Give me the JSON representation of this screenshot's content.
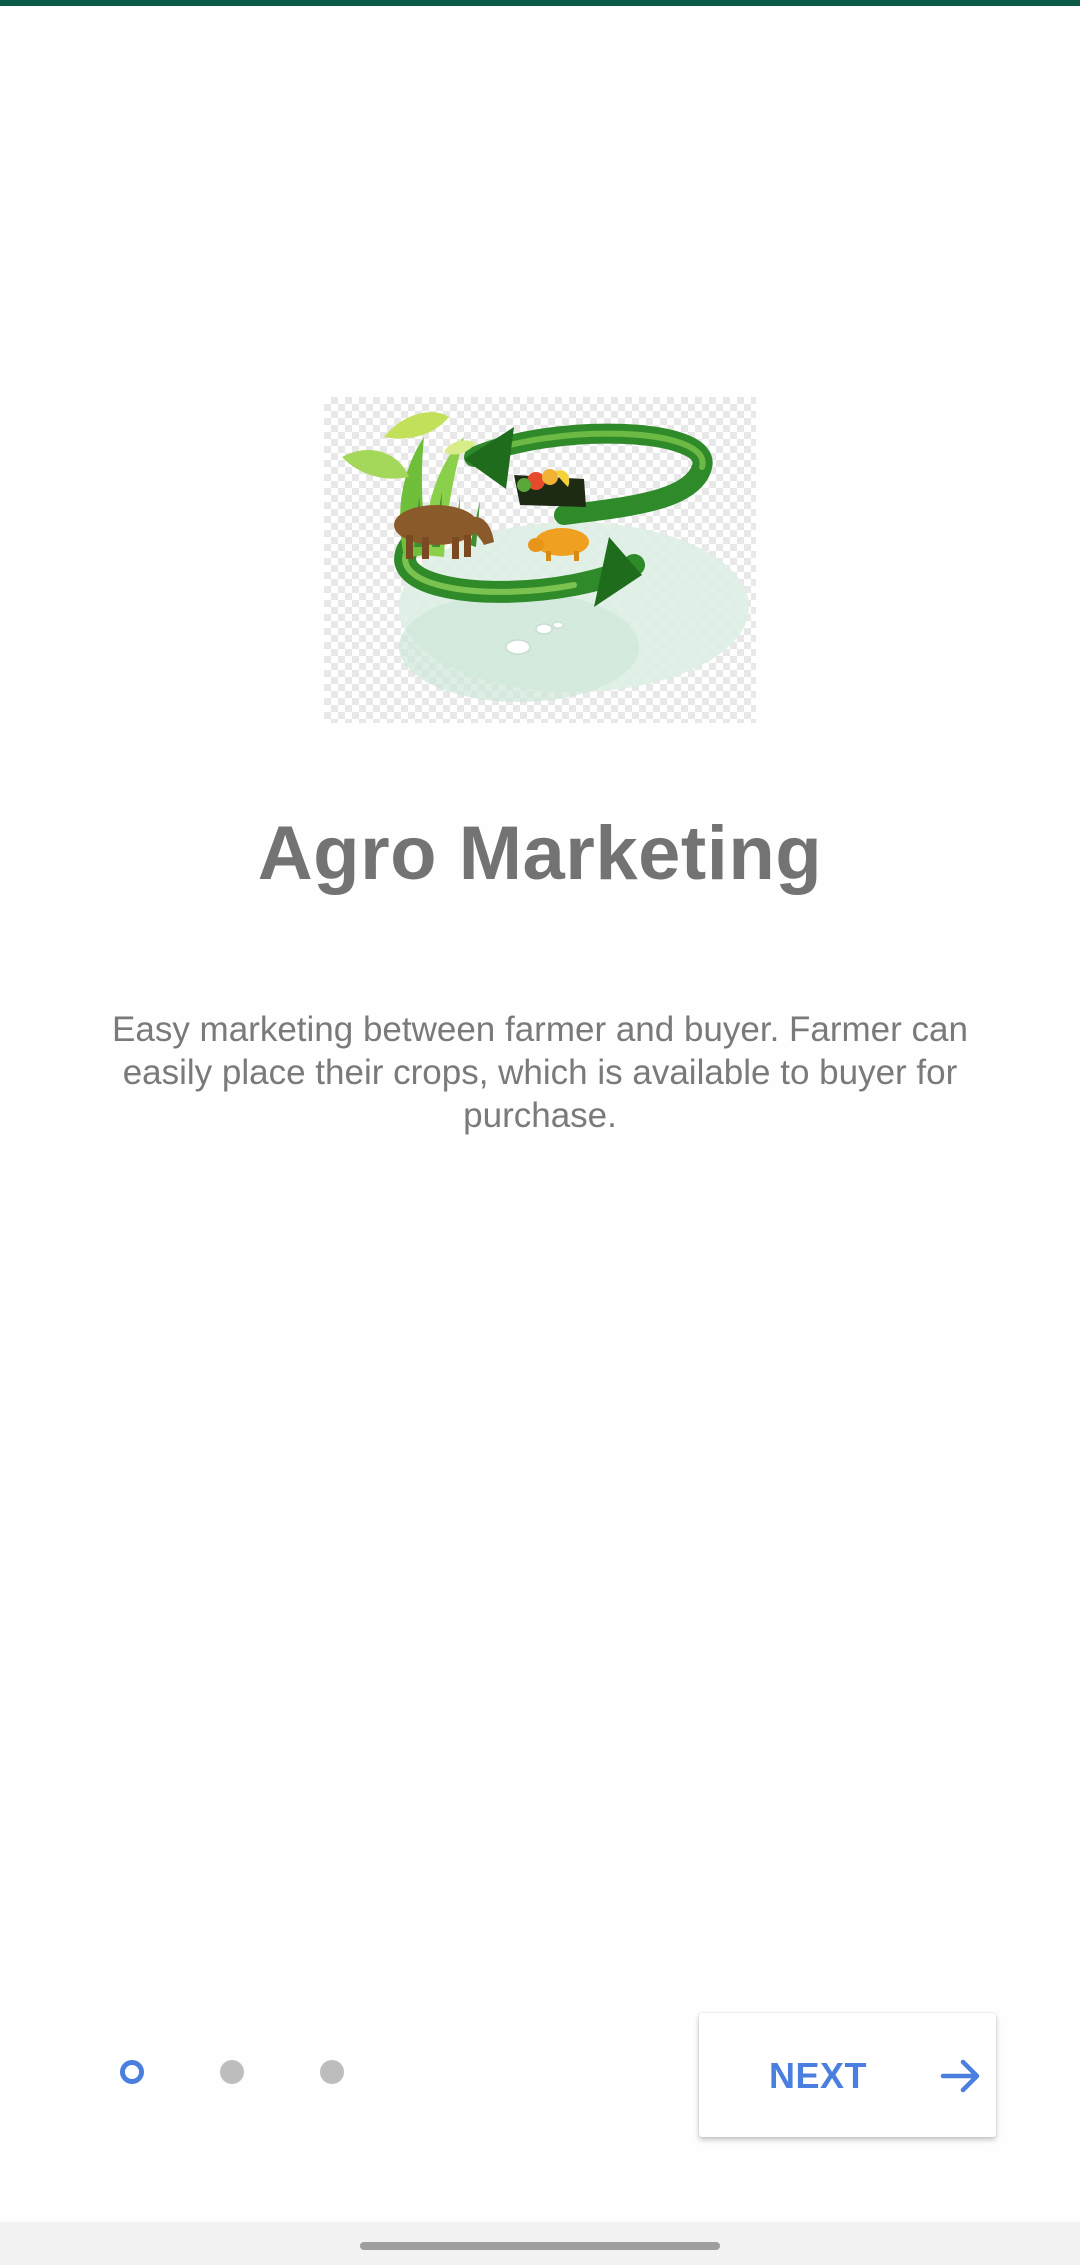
{
  "app": {
    "title": "Agro Marketing",
    "description": "Easy marketing between farmer and buyer. Farmer can easily place their crops, which is available to buyer for purchase.",
    "logo_icon": "agro-marketing-logo-icon"
  },
  "pager": {
    "total": 3,
    "current": 1
  },
  "actions": {
    "next_label": "NEXT",
    "next_icon": "arrow-right-icon"
  },
  "colors": {
    "status_bar": "#0b5a45",
    "accent": "#4a7fe0",
    "title_text": "#737373",
    "body_text": "#7a7a7a",
    "inactive_dot": "#bdbdbd"
  }
}
